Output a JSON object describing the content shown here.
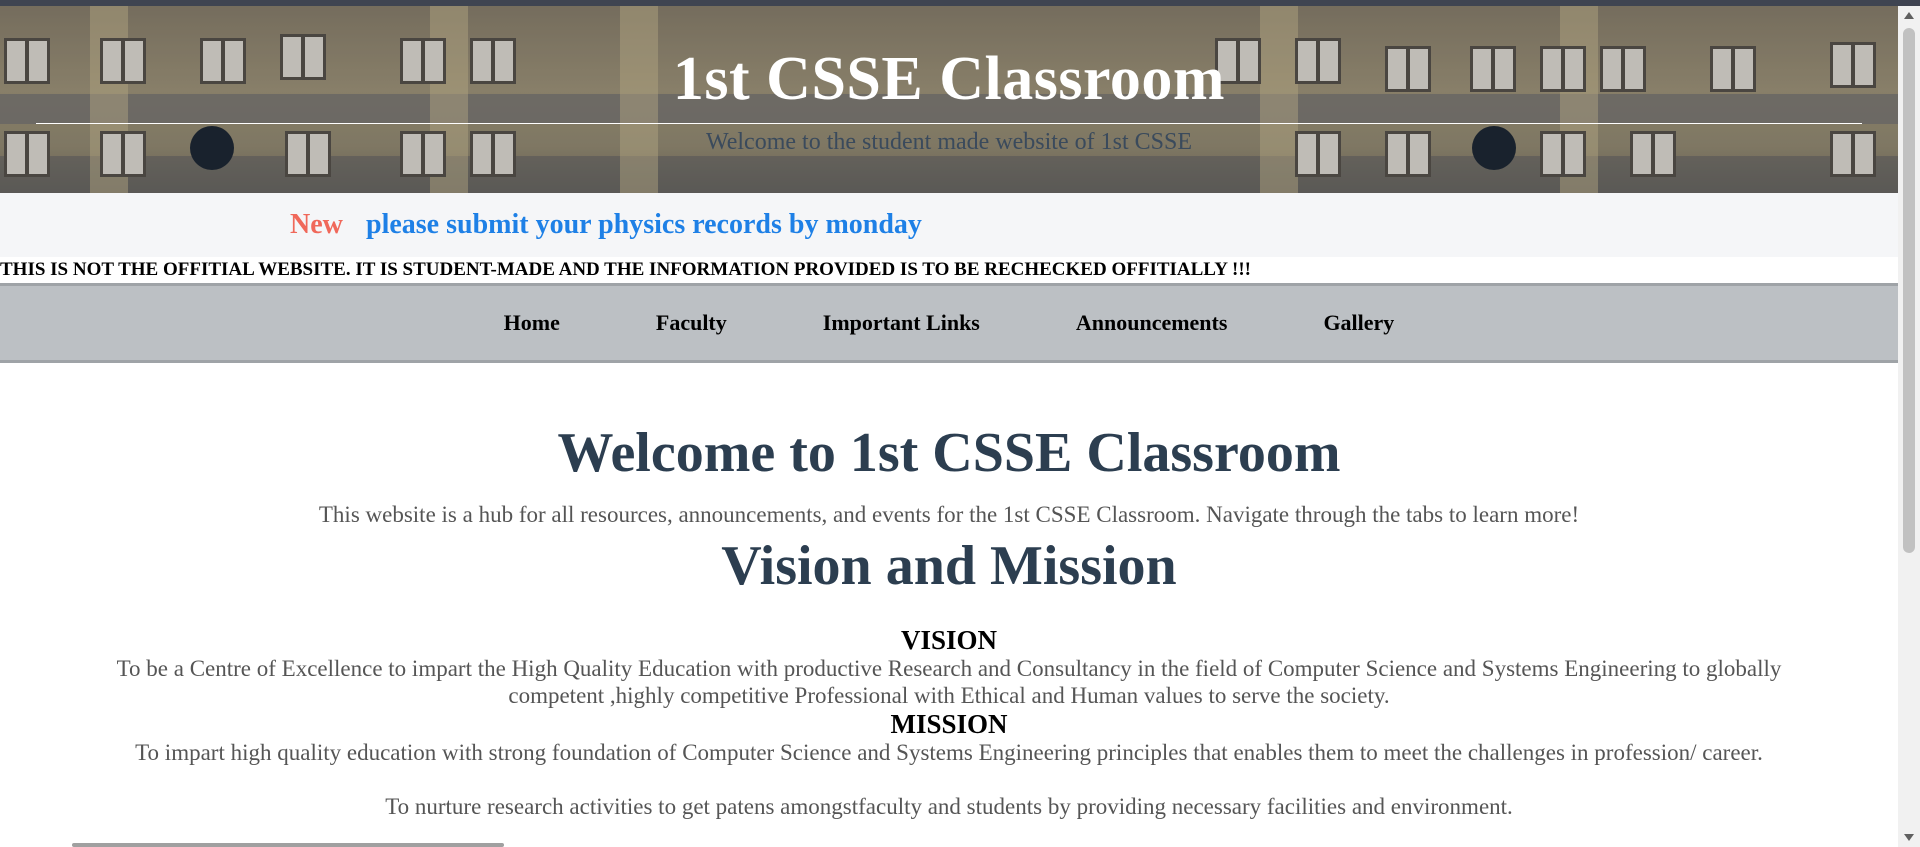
{
  "header": {
    "title": "1st CSSE Classroom",
    "subtitle": "Welcome to the student made website of 1st CSSE"
  },
  "ticker": {
    "badge": "New",
    "message": "please submit your physics records by monday",
    "badge_color": "#f0685a",
    "message_color": "#1e80e6"
  },
  "disclaimer": "THIS IS NOT THE OFFITIAL WEBSITE. IT IS STUDENT-MADE AND THE INFORMATION PROVIDED IS TO BE RECHECKED OFFITIALLY !!!",
  "nav": {
    "items": [
      {
        "label": "Home"
      },
      {
        "label": "Faculty"
      },
      {
        "label": "Important Links"
      },
      {
        "label": "Announcements"
      },
      {
        "label": "Gallery"
      }
    ]
  },
  "main": {
    "welcome_heading": "Welcome to 1st CSSE Classroom",
    "intro": "This website is a hub for all resources, announcements, and events for the 1st CSSE Classroom. Navigate through the tabs to learn more!",
    "vm_heading": "Vision and Mission",
    "vision_heading": "VISION",
    "vision_text": "To be a Centre of Excellence to impart the High Quality Education with productive Research and Consultancy in the field of Computer Science and Systems Engineering to globally competent ,highly competitive Professional with Ethical and Human values to serve the society.",
    "mission_heading": "MISSION",
    "mission_text_1": "To impart high quality education with strong foundation of Computer Science and Systems Engineering principles that enables them to meet the challenges in profession/ career.",
    "mission_text_2": "To nurture research activities to get patens amongstfaculty and students by providing necessary facilities and environment."
  },
  "colors": {
    "heading": "#2c3e50",
    "nav_bg": "#bcc0c4"
  }
}
